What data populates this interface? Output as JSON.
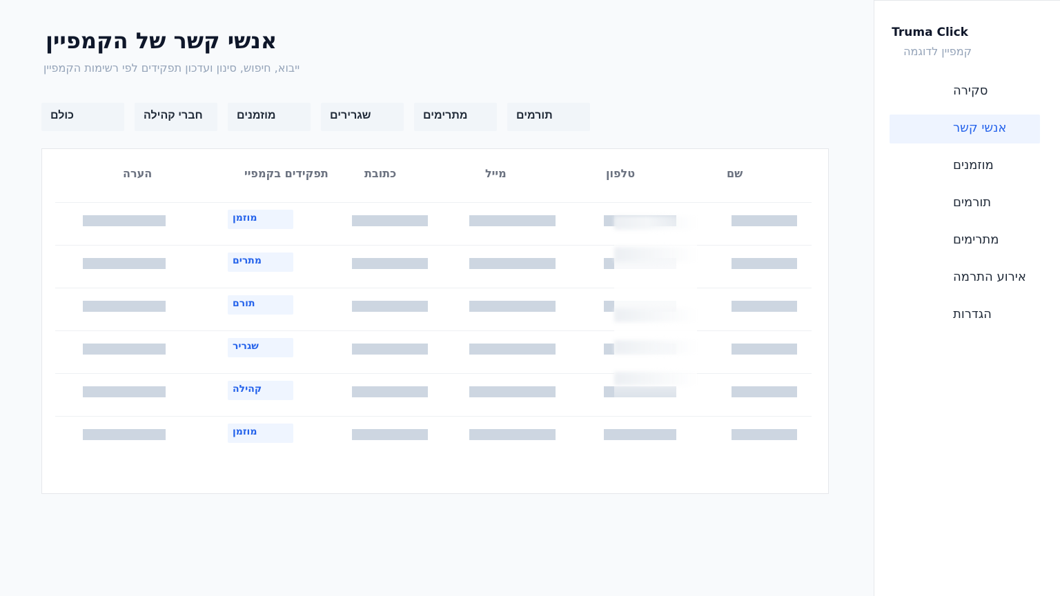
{
  "sidebar": {
    "brand_title": "Truma Click",
    "brand_subtitle": "קמפיין לדוגמה",
    "items": [
      {
        "label": "סקירה",
        "active": false
      },
      {
        "label": "אנשי קשר",
        "active": true
      },
      {
        "label": "מוזמנים",
        "active": false
      },
      {
        "label": "תורמים",
        "active": false
      },
      {
        "label": "מתרימים",
        "active": false
      },
      {
        "label": "אירוע התרמה",
        "active": false
      },
      {
        "label": "הגדרות",
        "active": false
      }
    ]
  },
  "header": {
    "title": "אנשי קשר של הקמפיין",
    "subtitle": "ייבוא, חיפוש, סינון ועדכון תפקידים לפי רשימות הקמפיין"
  },
  "filters": [
    {
      "label": "כולם"
    },
    {
      "label": "חברי קהילה"
    },
    {
      "label": "מוזמנים"
    },
    {
      "label": "שגרירים"
    },
    {
      "label": "מתרימים"
    },
    {
      "label": "תורמים"
    }
  ],
  "table": {
    "columns": {
      "name": "שם",
      "phone": "טלפון",
      "email": "מייל",
      "address": "כתובת",
      "roles": "תפקידים בקמפיי",
      "note": "הערה"
    },
    "rows": [
      {
        "role": "מוזמן"
      },
      {
        "role": "מתרים"
      },
      {
        "role": "תורם"
      },
      {
        "role": "שגריר"
      },
      {
        "role": "קהילה"
      },
      {
        "role": "מוזמן"
      }
    ]
  },
  "colors": {
    "accent": "#2563eb",
    "active_nav_bg": "#eef4ff",
    "role_badge_bg": "#eff5ff",
    "skeleton": "#cdd6e1",
    "page_bg": "#f8fafc"
  }
}
